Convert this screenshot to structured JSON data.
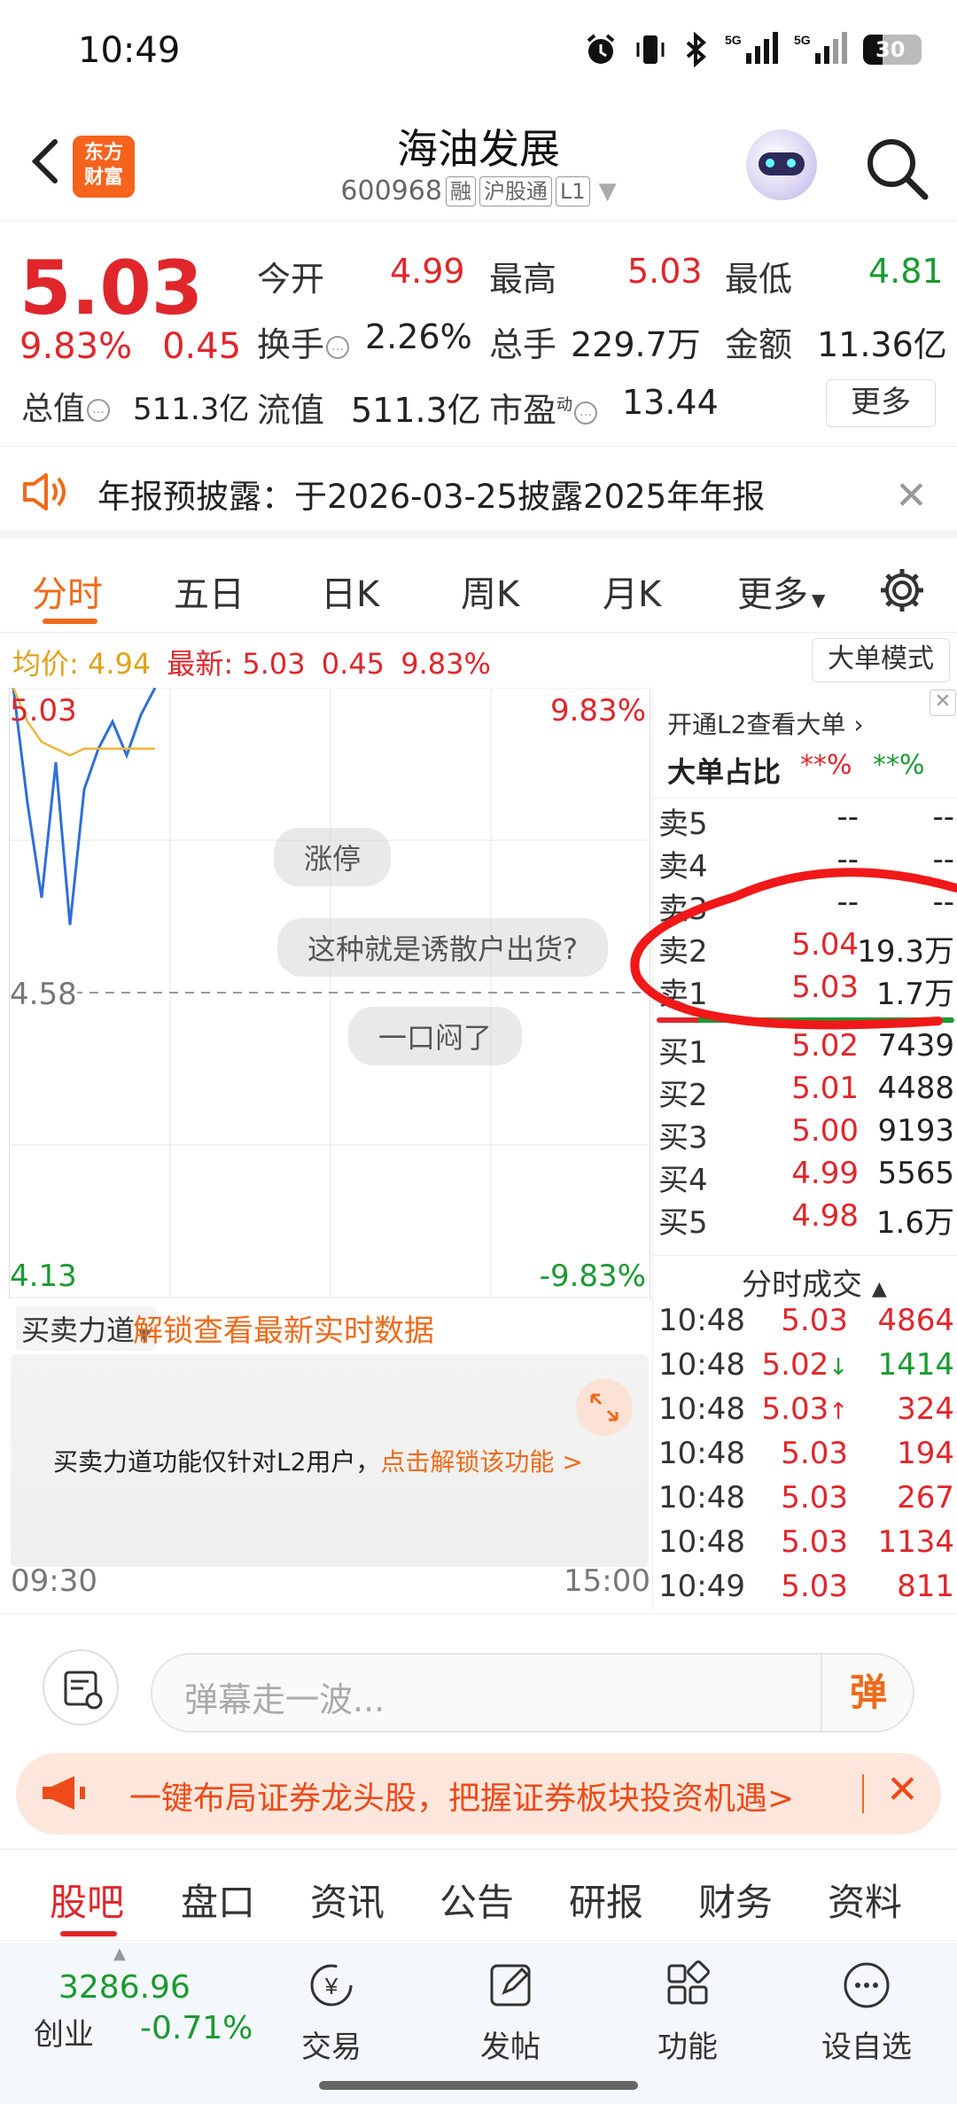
{
  "status": {
    "time": "10:49",
    "battery": "30"
  },
  "header": {
    "logo_line1": "东方",
    "logo_line2": "财富",
    "title": "海油发展",
    "code": "600968",
    "tags": [
      "融",
      "沪股通",
      "L1"
    ]
  },
  "quote": {
    "price": "5.03",
    "pct": "9.83%",
    "change": "0.45",
    "open_label": "今开",
    "open": "4.99",
    "high_label": "最高",
    "high": "5.03",
    "low_label": "最低",
    "low": "4.81",
    "turnover_label": "换手",
    "turnover": "2.26%",
    "volume_label": "总手",
    "volume": "229.7万",
    "amount_label": "金额",
    "amount": "11.36亿",
    "mktcap_label": "总值",
    "mktcap": "511.3亿",
    "float_label": "流值",
    "float": "511.3亿",
    "pe_label": "市盈",
    "pe_sup": "动",
    "pe": "13.44",
    "more_button": "更多"
  },
  "notice": {
    "text": "年报预披露：于2026-03-25披露2025年年报"
  },
  "tabs": {
    "items": [
      "分时",
      "五日",
      "日K",
      "周K",
      "月K",
      "更多"
    ],
    "active": "分时"
  },
  "info_line": {
    "avg_label": "均价:",
    "avg": "4.94",
    "latest_label": "最新:",
    "latest": "5.03",
    "change": "0.45",
    "pct": "9.83%",
    "big_order_mode": "大单模式"
  },
  "chart": {
    "top_left": "5.03",
    "top_right": "9.83%",
    "mid_left": "4.58",
    "bottom_left": "4.13",
    "bottom_right": "-9.83%",
    "danmu": [
      "涨停",
      "这种就是诱散户出货?",
      "一口闷了"
    ]
  },
  "chart_data": {
    "type": "line",
    "series": [
      {
        "values": [
          5.03,
          4.86,
          4.72,
          4.92,
          4.68,
          4.88,
          4.94,
          4.98,
          4.93,
          4.99,
          5.03
        ]
      },
      {
        "values": [
          5.03,
          4.98,
          4.95,
          4.94,
          4.93,
          4.94,
          4.94,
          4.94,
          4.94,
          4.94,
          4.94
        ]
      }
    ],
    "ylim": [
      4.13,
      5.03
    ]
  },
  "orderbook": {
    "open_l2": "开通L2查看大单",
    "ratio_label": "大单占比",
    "ratio_red": "**%",
    "ratio_green": "**%",
    "asks": [
      {
        "label": "卖5",
        "price": "--",
        "vol": "--"
      },
      {
        "label": "卖4",
        "price": "--",
        "vol": "--"
      },
      {
        "label": "卖3",
        "price": "--",
        "vol": "--"
      },
      {
        "label": "卖2",
        "price": "5.04",
        "vol": "19.3万"
      },
      {
        "label": "卖1",
        "price": "5.03",
        "vol": "1.7万"
      }
    ],
    "bids": [
      {
        "label": "买1",
        "price": "5.02",
        "vol": "7439"
      },
      {
        "label": "买2",
        "price": "5.01",
        "vol": "4488"
      },
      {
        "label": "买3",
        "price": "5.00",
        "vol": "9193"
      },
      {
        "label": "买4",
        "price": "4.99",
        "vol": "5565"
      },
      {
        "label": "买5",
        "price": "4.98",
        "vol": "1.6万"
      }
    ]
  },
  "trades": {
    "title": "分时成交",
    "rows": [
      {
        "time": "10:48",
        "price": "5.03",
        "arrow": "",
        "vol": "4864",
        "vol_color": "red"
      },
      {
        "time": "10:48",
        "price": "5.02",
        "arrow": "↓",
        "vol": "1414",
        "vol_color": "green"
      },
      {
        "time": "10:48",
        "price": "5.03",
        "arrow": "↑",
        "vol": "324",
        "vol_color": "red"
      },
      {
        "time": "10:48",
        "price": "5.03",
        "arrow": "",
        "vol": "194",
        "vol_color": "red"
      },
      {
        "time": "10:48",
        "price": "5.03",
        "arrow": "",
        "vol": "267",
        "vol_color": "red"
      },
      {
        "time": "10:48",
        "price": "5.03",
        "arrow": "",
        "vol": "1134",
        "vol_color": "red"
      },
      {
        "time": "10:49",
        "price": "5.03",
        "arrow": "",
        "vol": "811",
        "vol_color": "red"
      }
    ]
  },
  "buysell": {
    "selector": "买卖力道",
    "unlock": "解锁查看最新实时数据",
    "msg": "买卖力道功能仅针对L2用户，",
    "msg_link": "点击解锁该功能 >",
    "time_start": "09:30",
    "time_end": "15:00"
  },
  "danmu_bar": {
    "placeholder": "弹幕走一波...",
    "send": "弹"
  },
  "promo": {
    "text": "一键布局证券龙头股，把握证券板块投资机遇>"
  },
  "bottom_tabs": {
    "items": [
      "股吧",
      "盘口",
      "资讯",
      "公告",
      "研报",
      "财务",
      "资料"
    ],
    "active": "股吧"
  },
  "toolbar": {
    "index_value": "3286.96",
    "index_name": "创业",
    "index_pct": "-0.71%",
    "tools": [
      "交易",
      "发帖",
      "功能",
      "设自选"
    ]
  },
  "colors": {
    "up": "#e0262b",
    "down": "#1a9a31",
    "accent": "#ef6a19"
  }
}
